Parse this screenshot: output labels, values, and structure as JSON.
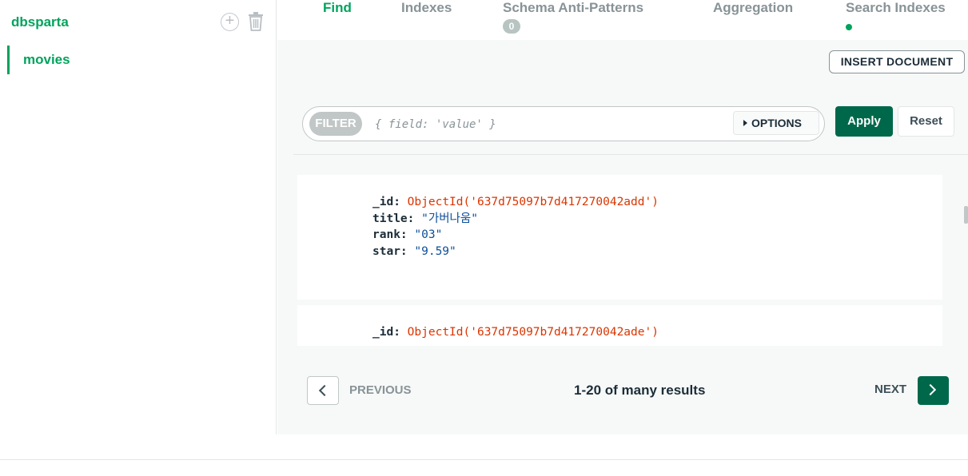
{
  "sidebar": {
    "database": "dbsparta",
    "collections": [
      {
        "label": "movies"
      }
    ]
  },
  "tabs": [
    {
      "label": "Find"
    },
    {
      "label": "Indexes"
    },
    {
      "label": "Schema Anti-Patterns",
      "badge": "0"
    },
    {
      "label": "Aggregation"
    },
    {
      "label": "Search Indexes"
    }
  ],
  "toolbar": {
    "insert_label": "INSERT DOCUMENT"
  },
  "filter": {
    "label": "FILTER",
    "placeholder": "{ field: 'value' }",
    "options_label": "OPTIONS",
    "apply_label": "Apply",
    "reset_label": "Reset"
  },
  "documents": [
    {
      "fields": [
        {
          "key": "_id",
          "value": "ObjectId('637d75097b7d417270042add')"
        },
        {
          "key": "title",
          "value": "\"가버나움\""
        },
        {
          "key": "rank",
          "value": "\"03\""
        },
        {
          "key": "star",
          "value": "\"9.59\""
        }
      ]
    },
    {
      "fields": [
        {
          "key": "_id",
          "value": "ObjectId('637d75097b7d417270042ade')"
        }
      ]
    }
  ],
  "pagination": {
    "previous_label": "PREVIOUS",
    "results_text": "1-20 of many results",
    "next_label": "NEXT"
  },
  "colors": {
    "accent": "#00a35c",
    "primary_button": "#00684a",
    "object_id": "#db3500",
    "string_value": "#0d4f99"
  }
}
